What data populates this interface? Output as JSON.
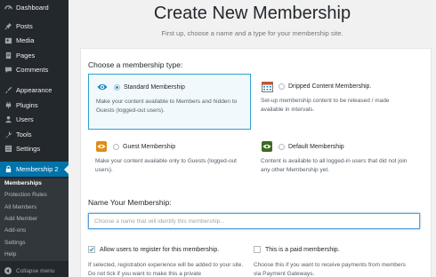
{
  "sidebar": {
    "items": [
      {
        "label": "Dashboard",
        "icon": "dashboard-icon"
      },
      {
        "label": "Posts",
        "icon": "pin-icon"
      },
      {
        "label": "Media",
        "icon": "media-icon"
      },
      {
        "label": "Pages",
        "icon": "pages-icon"
      },
      {
        "label": "Comments",
        "icon": "comment-icon"
      },
      {
        "label": "Appearance",
        "icon": "brush-icon"
      },
      {
        "label": "Plugins",
        "icon": "plugin-icon"
      },
      {
        "label": "Users",
        "icon": "user-icon"
      },
      {
        "label": "Tools",
        "icon": "wrench-icon"
      },
      {
        "label": "Settings",
        "icon": "settings-icon"
      },
      {
        "label": "Membership 2",
        "icon": "lock-icon"
      }
    ],
    "submenu": [
      "Memberships",
      "Protection Rules",
      "All Members",
      "Add Member",
      "Add-ons",
      "Settings",
      "Help"
    ],
    "collapse_label": "Collapse menu",
    "accent": "#0073aa"
  },
  "header": {
    "title": "Create New Membership",
    "subtitle": "First up, choose a name and a type for your membership site."
  },
  "types": {
    "heading": "Choose a membership type:",
    "options": [
      {
        "name": "Standard Membership",
        "desc": "Make your content available to Members and hidden to Guests (logged-out users).",
        "selected": true,
        "icon": "eye-icon"
      },
      {
        "name": "Dripped Content Membership.",
        "desc": "Set-up membership content to be released / made available in intervals.",
        "selected": false,
        "icon": "calendar-icon"
      },
      {
        "name": "Guest Membership",
        "desc": "Make your content available only to Guests (logged-out users).",
        "selected": false,
        "icon": "eye-icon"
      },
      {
        "name": "Default Membership",
        "desc": "Content is available to all logged-in users that did not join any other Membership yet.",
        "selected": false,
        "icon": "eye-icon"
      }
    ]
  },
  "name_section": {
    "heading": "Name Your Membership:",
    "value": "",
    "placeholder": "Choose a name that will identify this membership..."
  },
  "options": {
    "register": {
      "label": "Allow users to register for this membership.",
      "checked": true,
      "desc": "If selected, registration experience will be added to your site. Do not tick if you want to make this a private"
    },
    "paid": {
      "label": "This is a paid membership.",
      "checked": false,
      "desc": "Choose this if you want to receive payments from members via Payment Gateways."
    }
  }
}
